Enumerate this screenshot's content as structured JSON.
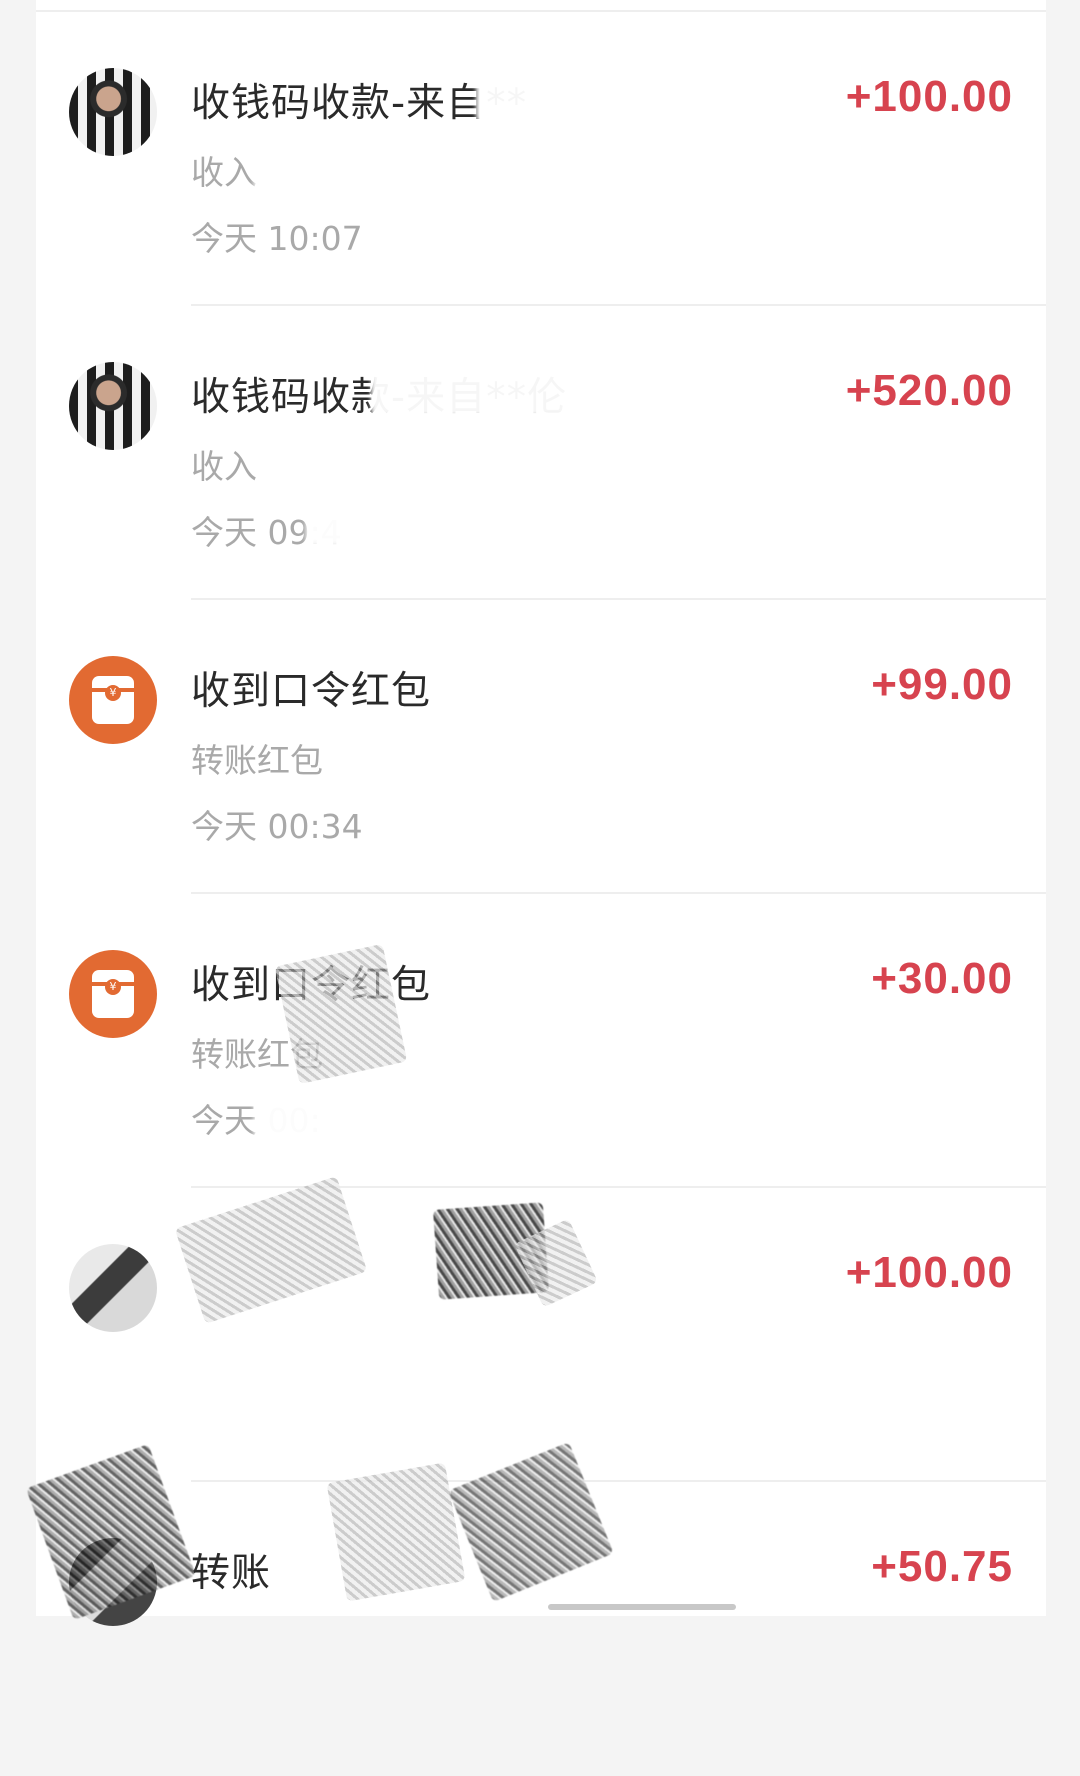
{
  "transactions": [
    {
      "title": "收钱码收款-来自**",
      "subtitle": "收入",
      "time": "今天 10:07",
      "amount": "+100.00",
      "avatar": "user-photo"
    },
    {
      "title": "收钱码收款-来自**伦",
      "subtitle": "收入",
      "time": "今天 09:4",
      "amount": "+520.00",
      "avatar": "user-photo"
    },
    {
      "title": "收到口令红包",
      "subtitle": "转账红包",
      "time": "今天 00:34",
      "amount": "+99.00",
      "avatar": "red-packet-icon"
    },
    {
      "title": "收到口令红包",
      "subtitle": "转账红包",
      "time": "今天 00:",
      "amount": "+30.00",
      "avatar": "red-packet-icon"
    },
    {
      "title": "",
      "subtitle": "",
      "time": "",
      "amount": "+100.00",
      "avatar": "user-photo"
    },
    {
      "title": "转账",
      "subtitle": "",
      "time": "",
      "amount": "+50.75",
      "avatar": "user-photo"
    }
  ],
  "colors": {
    "amount": "#d7434f",
    "red_packet": "#e26a32",
    "secondary_text": "#a9a9a9"
  }
}
